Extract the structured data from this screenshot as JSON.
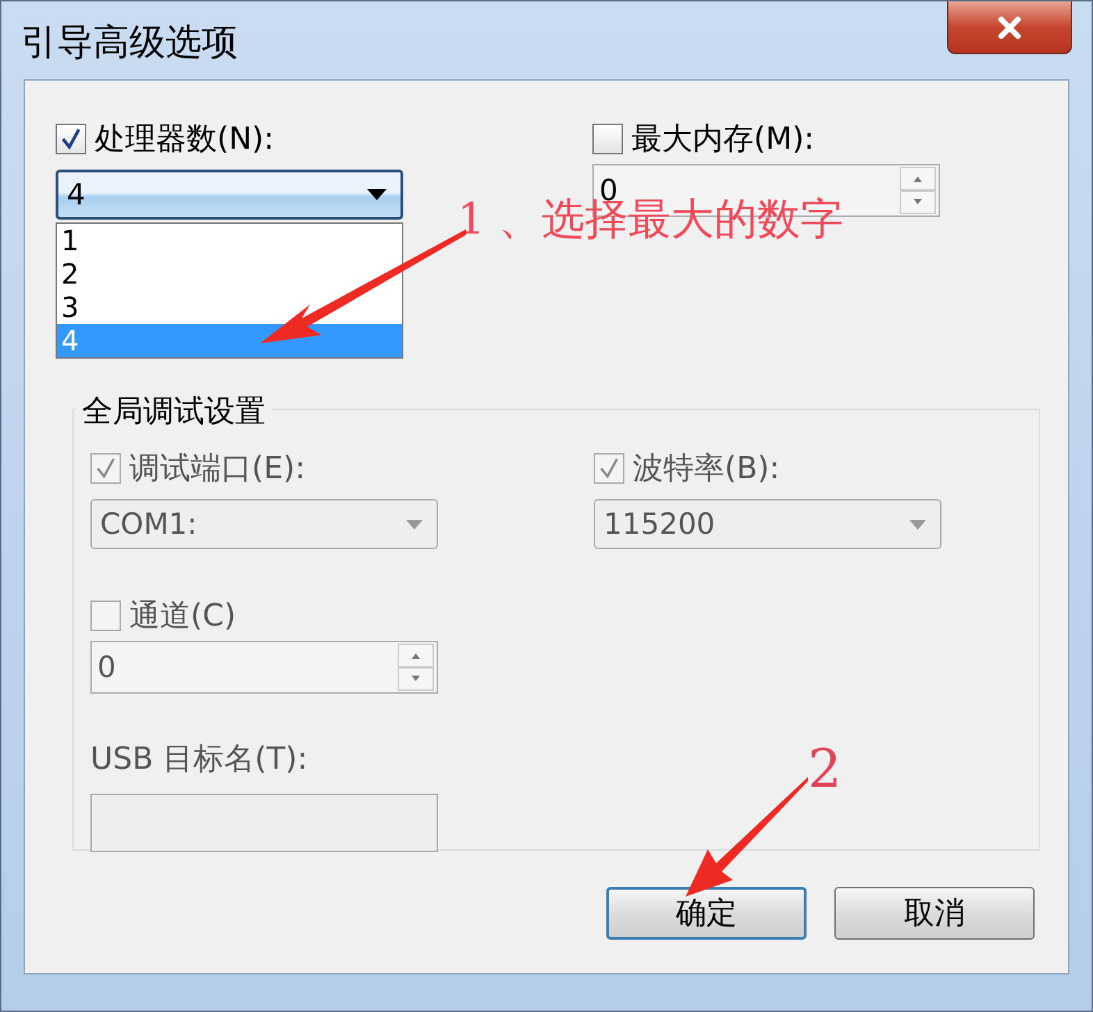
{
  "window": {
    "title": "引导高级选项"
  },
  "processors": {
    "label": "处理器数(N):",
    "checked": true,
    "value": "4",
    "expanded": true,
    "options": [
      {
        "label": "1",
        "selected": false
      },
      {
        "label": "2",
        "selected": false
      },
      {
        "label": "3",
        "selected": false
      },
      {
        "label": "4",
        "selected": true
      }
    ]
  },
  "max_memory": {
    "label": "最大内存(M):",
    "checked": false,
    "value": "0"
  },
  "debug_group": {
    "title": "全局调试设置",
    "disabled": true,
    "debug_port": {
      "label": "调试端口(E):",
      "checked": true,
      "value": "COM1:"
    },
    "baud_rate": {
      "label": "波特率(B):",
      "checked": true,
      "value": "115200"
    },
    "channel": {
      "label": "通道(C)",
      "checked": false,
      "value": "0"
    },
    "usb_target": {
      "label": "USB 目标名(T):"
    }
  },
  "buttons": [
    {
      "label": "确定",
      "default": true
    },
    {
      "label": "取消",
      "default": false
    }
  ],
  "annotations": [
    {
      "text": "1 、选择最大的数字"
    },
    {
      "text": "2"
    }
  ]
}
